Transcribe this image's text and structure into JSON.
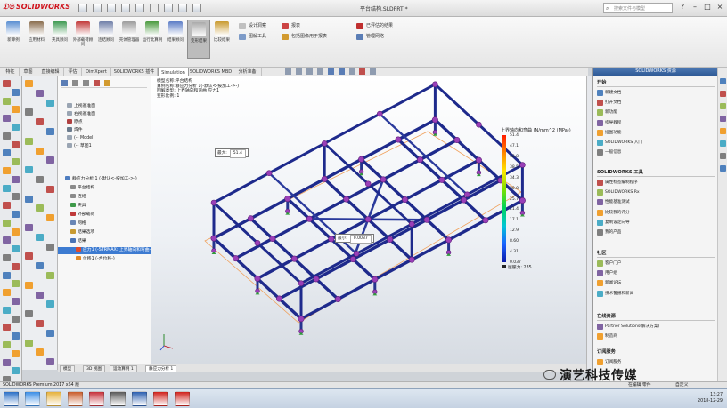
{
  "app": {
    "logo_text": "SOLIDWORKS",
    "document_title": "平台结构.SLDPRT *",
    "search_placeholder": "搜索文件与模型",
    "window_buttons": [
      "?",
      "–",
      "□",
      "×"
    ]
  },
  "ribbon": {
    "buttons": [
      {
        "label": "新算例",
        "color": "#5a8fd2"
      },
      {
        "label": "应用材料",
        "color": "#8a6d4e"
      },
      {
        "label": "夹具顾问",
        "color": "#3e9a52"
      },
      {
        "label": "外部载荷顾问",
        "color": "#c23a3a"
      },
      {
        "label": "连结顾问",
        "color": "#6f7fa8"
      },
      {
        "label": "壳体管理器",
        "color": "#9c9c9c"
      },
      {
        "label": "运行此算例",
        "color": "#4a9a3e"
      },
      {
        "label": "结果顾问",
        "color": "#5b7cc6"
      },
      {
        "label": "变形结果",
        "color": "#aaaaaa"
      },
      {
        "label": "比较结果",
        "color": "#c99a2e"
      }
    ],
    "small_items": [
      {
        "label": "设计洞察",
        "color": "#c0c0c0"
      },
      {
        "label": "图解工具",
        "color": "#7d9bc8"
      },
      {
        "label": "报表",
        "color": "#c44"
      },
      {
        "label": "包括图像用于报表",
        "color": "#d29a2f"
      },
      {
        "label": "已评估的结果",
        "color": "#c03030"
      },
      {
        "label": "管理网络",
        "color": "#5a7db5"
      }
    ]
  },
  "tabs": [
    "特征",
    "草图",
    "直接编辑",
    "评估",
    "DimXpert",
    "SOLIDWORKS 插件",
    "Simulation",
    "SOLIDWORKS MBD",
    "分析准备"
  ],
  "active_tab": "Simulation",
  "tree": {
    "items": [
      {
        "label": "上视基准面",
        "color": "#9aa5b3"
      },
      {
        "label": "右视基准面",
        "color": "#9aa5b3"
      },
      {
        "label": "原点",
        "color": "#b04040"
      },
      {
        "label": "焊件",
        "color": "#6b7b8d"
      },
      {
        "label": "(-) Model",
        "color": "#9aa5b3"
      },
      {
        "label": "(-) 草图1",
        "color": "#9aa5b3"
      }
    ],
    "study_items": [
      {
        "label": "静应力分析 1 (-默认<-按加工->-)",
        "color": "#4f7dc0",
        "selected": false
      },
      {
        "label": "平台结构",
        "color": "#8a8a8a",
        "selected": false
      },
      {
        "label": "连结",
        "color": "#8a8a8a",
        "selected": false
      },
      {
        "label": "夹具",
        "color": "#3f9a4a",
        "selected": false
      },
      {
        "label": "外部载荷",
        "color": "#c03a3a",
        "selected": false
      },
      {
        "label": "网格",
        "color": "#6a86b4",
        "selected": false
      },
      {
        "label": "结果选项",
        "color": "#c89a30",
        "selected": false
      },
      {
        "label": "结果",
        "color": "#4a74b5",
        "selected": false
      },
      {
        "label": "应力1 (-STRMAX: 上界轴向和弯曲-)",
        "color": "#e04a2a",
        "selected": true
      },
      {
        "label": "位移1 (-合位移-)",
        "color": "#e08a2a",
        "selected": false
      }
    ]
  },
  "viewport": {
    "header_lines": [
      "模型名称:平台结构",
      "算例名称:静应力分析 1(-默认<-按加工->-)",
      "图解类型: 上界轴向和弯曲 应力1",
      "变形比例: 1"
    ],
    "probes": [
      {
        "name": "max-probe",
        "label": "最大:",
        "value": "51.4"
      },
      {
        "name": "min-probe",
        "label": "最小:",
        "value": "0.0037"
      }
    ]
  },
  "chart_data": {
    "type": "heatmap",
    "title": "上界轴向和弯曲 (N/mm^2 (MPa))",
    "ticks": [
      "51.4",
      "47.1",
      "42.8",
      "38.5",
      "34.3",
      "30.0",
      "25.7",
      "21.4",
      "17.1",
      "12.9",
      "8.60",
      "4.31",
      "0.037"
    ],
    "range": [
      0.037,
      51.4
    ],
    "colors": [
      "#ff1a00",
      "#ff8a00",
      "#ffe600",
      "#7ae000",
      "#00d35a",
      "#00c6d6",
      "#1a62ff",
      "#0a1aa8"
    ],
    "yield_label": "屈服力: 235"
  },
  "bottom_tabs": [
    "模型",
    "3D 视图",
    "运动算例 1",
    "静应力分析 1"
  ],
  "active_bottom_tab": "静应力分析 1",
  "taskpane": {
    "header": "SOLIDWORKS 资源",
    "sections": [
      {
        "title": "开始",
        "items": [
          "新建文档",
          "打开文档",
          "新功能",
          "指导教程",
          "插图功能",
          "SOLIDWORKS 入门",
          "一般信息"
        ]
      },
      {
        "title": "SOLIDWORKS 工具",
        "items": [
          "属性标签编制程序",
          "SOLIDWORKS Rx",
          "性能基准测试",
          "比较我的评分",
          "复制设定向导",
          "我的产品"
        ]
      },
      {
        "title": "社区",
        "items": [
          "客户门户",
          "用户组",
          "新闻论坛",
          "技术警报和新闻"
        ]
      },
      {
        "title": "在线资源",
        "items": [
          "Partner Solutions(解决方案)",
          "制造商"
        ]
      },
      {
        "title": "订阅服务",
        "items": [
          "订阅服务"
        ]
      }
    ]
  },
  "statusbar": {
    "left": "SOLIDWORKS Premium 2017 x64 版",
    "right_edit": "在编辑 零件",
    "right_custom": "自定义"
  },
  "watermark": "演艺科技传媒",
  "taskbar": {
    "icons": [
      {
        "name": "start-icon",
        "color": "#2b6fc6"
      },
      {
        "name": "ie-icon",
        "color": "#3a8ee6"
      },
      {
        "name": "explorer-icon",
        "color": "#e6b13a"
      },
      {
        "name": "media-icon",
        "color": "#c95c2a"
      },
      {
        "name": "app-icon",
        "color": "#c6303a"
      },
      {
        "name": "app2-icon",
        "color": "#5a5a5a"
      },
      {
        "name": "word-icon",
        "color": "#2b5fb0"
      },
      {
        "name": "solidworks-icon",
        "color": "#d0211b"
      },
      {
        "name": "app3-icon",
        "color": "#d0211b"
      }
    ],
    "time": "13:27",
    "date": "2018-12-29"
  }
}
